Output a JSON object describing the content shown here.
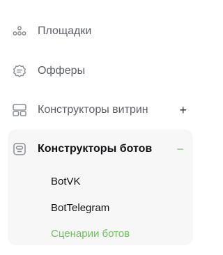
{
  "menu": {
    "items": [
      {
        "label": "Площадки",
        "icon": "dots-pyramid-icon"
      },
      {
        "label": "Офферы",
        "icon": "offer-badge-icon"
      },
      {
        "label": "Конструкторы витрин",
        "icon": "showcase-layout-icon",
        "toggle": "+"
      }
    ],
    "group": {
      "label": "Конструкторы ботов",
      "icon": "bot-icon",
      "toggle": "−",
      "subitems": [
        {
          "label": "BotVK",
          "active": false
        },
        {
          "label": "BotTelegram",
          "active": false
        },
        {
          "label": "Сценарии ботов",
          "active": true
        }
      ]
    }
  },
  "colors": {
    "accent": "#6cc25a",
    "muted_text": "#5c6066",
    "icon": "#8a8e94",
    "group_bg": "#f7f7f8"
  }
}
